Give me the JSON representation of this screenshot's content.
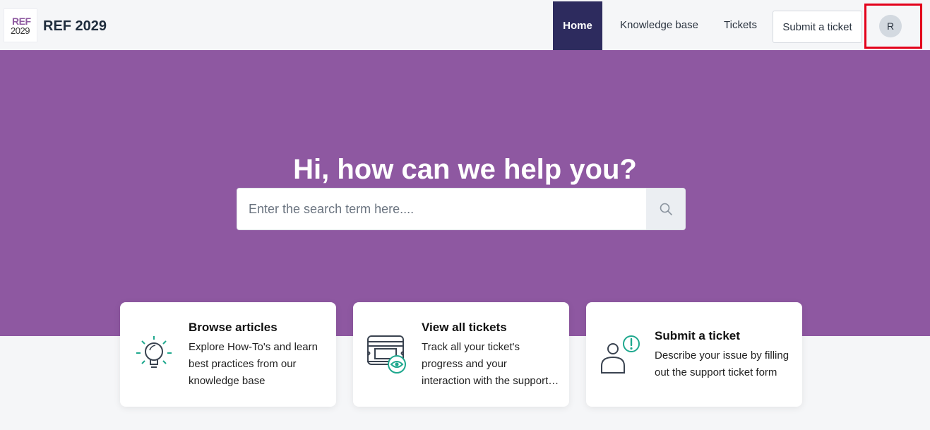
{
  "brand": {
    "logo_line1": "REF",
    "logo_line2": "2029",
    "name": "REF 2029"
  },
  "nav": {
    "home": "Home",
    "knowledge_base": "Knowledge base",
    "tickets": "Tickets",
    "submit_ticket": "Submit a ticket",
    "avatar_initial": "R"
  },
  "hero": {
    "title": "Hi, how can we help you?",
    "search_placeholder": "Enter the search term here...."
  },
  "cards": [
    {
      "title": "Browse articles",
      "description": "Explore How-To's and learn best practices from our knowledge base",
      "icon": "lightbulb-icon"
    },
    {
      "title": "View all tickets",
      "description_line1": "Track all your ticket's progress and your",
      "description_line2": "interaction with the support team",
      "icon": "tickets-eye-icon"
    },
    {
      "title": "Submit a ticket",
      "description": "Describe your issue by filling out the support ticket form",
      "icon": "person-alert-icon"
    }
  ],
  "colors": {
    "hero": "#8e58a1",
    "nav_active": "#2d2b5e",
    "icon_accent": "#1fa88e",
    "highlight": "#e3001b"
  }
}
